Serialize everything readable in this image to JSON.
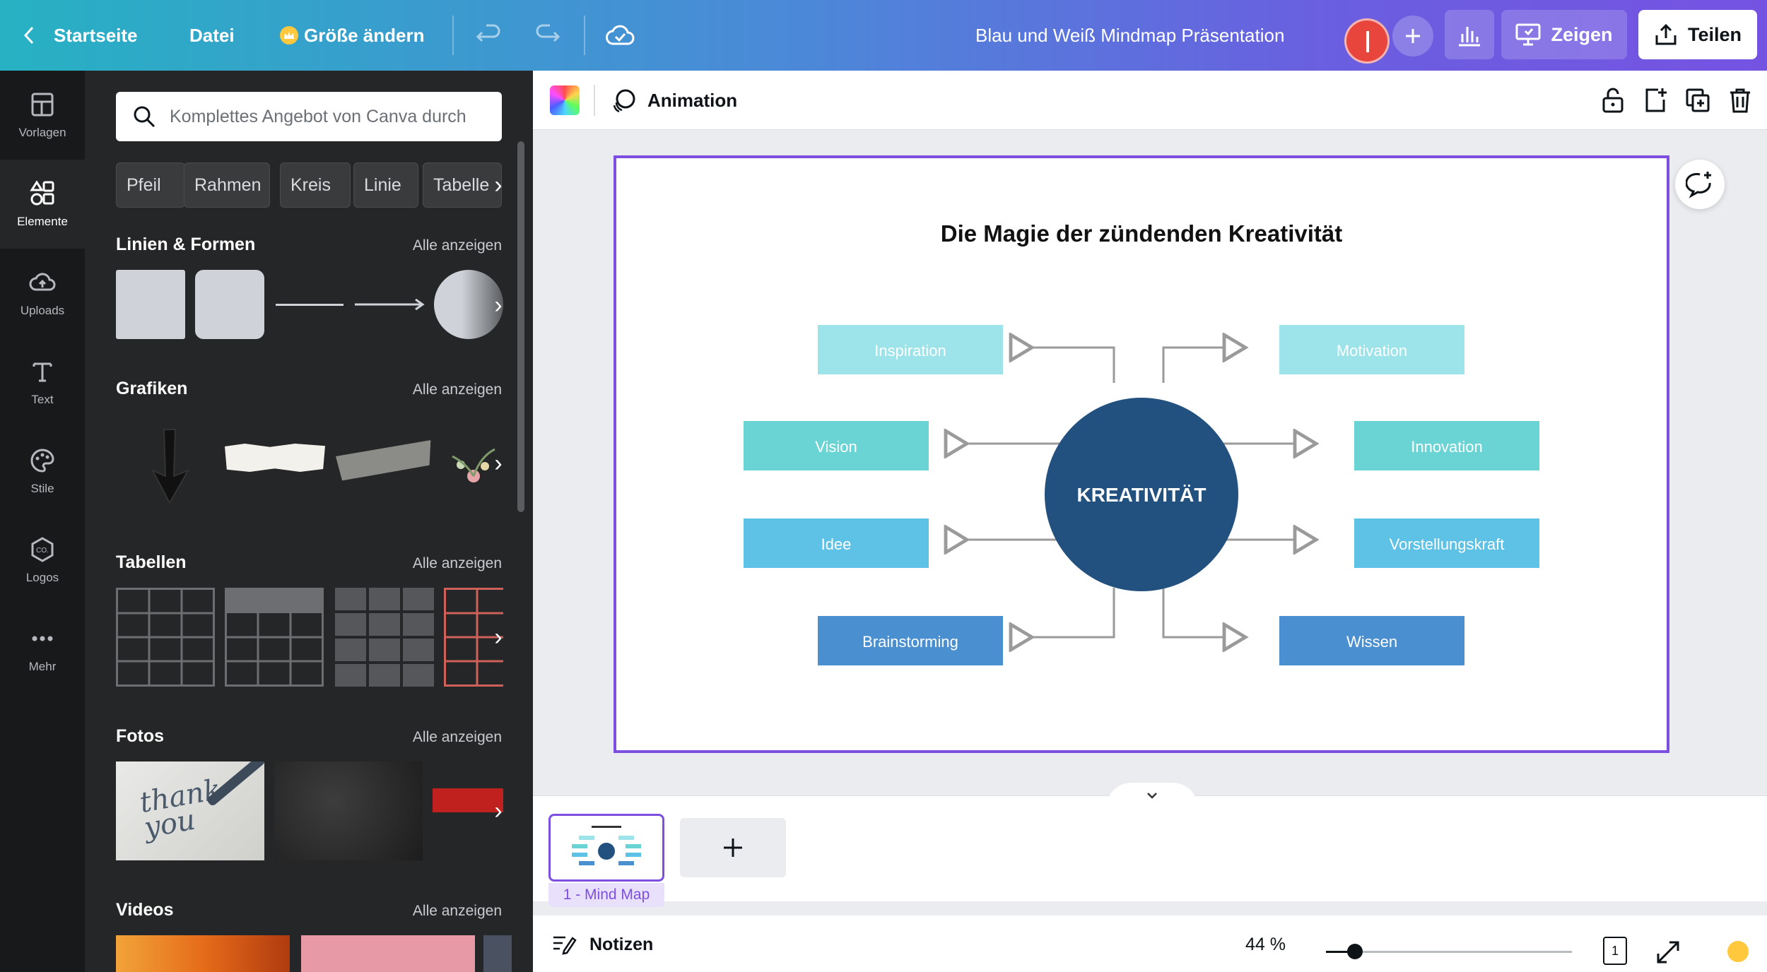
{
  "topbar": {
    "home_label": "Startseite",
    "file_label": "Datei",
    "resize_label": "Größe ändern",
    "doc_title": "Blau und Weiß Mindmap Präsentation",
    "present_label": "Zeigen",
    "share_label": "Teilen",
    "avatar_color": "#e8453c"
  },
  "leftnav": {
    "items": [
      {
        "label": "Vorlagen",
        "icon": "template-icon"
      },
      {
        "label": "Elemente",
        "icon": "elements-icon"
      },
      {
        "label": "Uploads",
        "icon": "cloud-upload-icon"
      },
      {
        "label": "Text",
        "icon": "text-icon"
      },
      {
        "label": "Stile",
        "icon": "palette-icon"
      },
      {
        "label": "Logos",
        "icon": "logo-icon"
      },
      {
        "label": "Mehr",
        "icon": "more-icon"
      }
    ],
    "active": "Elemente"
  },
  "panel": {
    "search_placeholder": "Komplettes Angebot von Canva durch",
    "chips": [
      "Pfeil",
      "Rahmen",
      "Kreis",
      "Linie",
      "Tabelle"
    ],
    "sections": [
      {
        "title": "Linien & Formen",
        "link": "Alle anzeigen"
      },
      {
        "title": "Grafiken",
        "link": "Alle anzeigen"
      },
      {
        "title": "Tabellen",
        "link": "Alle anzeigen"
      },
      {
        "title": "Fotos",
        "link": "Alle anzeigen"
      },
      {
        "title": "Videos",
        "link": "Alle anzeigen"
      }
    ],
    "photo_text": "thank you"
  },
  "toolbar": {
    "animation_label": "Animation"
  },
  "slide": {
    "title": "Die Magie der zündenden Kreativität",
    "center": "KREATIVITÄT",
    "center_color": "#22507f",
    "nodes": {
      "inspiration": "Inspiration",
      "motivation": "Motivation",
      "vision": "Vision",
      "innovation": "Innovation",
      "idee": "Idee",
      "vorstellungskraft": "Vorstellungskraft",
      "brainstorming": "Brainstorming",
      "wissen": "Wissen"
    },
    "colors": {
      "light": "#9ce4ea",
      "teal": "#6ad3d4",
      "sky": "#5dc2e6",
      "blue": "#4a8fd0"
    }
  },
  "pages": {
    "thumb_label": "1 - Mind Map"
  },
  "footer": {
    "notes_label": "Notizen",
    "zoom_label": "44 %",
    "zoom_value": 44,
    "page_count": "1"
  }
}
